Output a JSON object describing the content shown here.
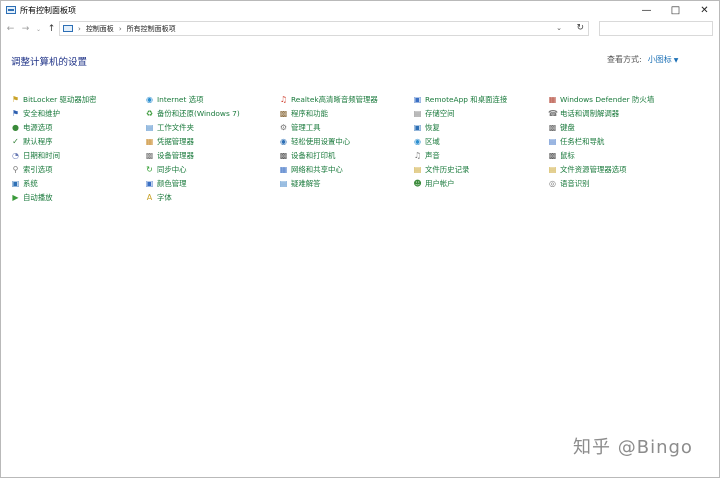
{
  "window": {
    "title": "所有控制面板项"
  },
  "addressbar": {
    "breadcrumbs": [
      "控制面板",
      "所有控制面板项"
    ]
  },
  "heading": "调整计算机的设置",
  "view_by": {
    "label": "查看方式:",
    "value": "小图标"
  },
  "columns": [
    [
      {
        "label": "BitLocker 驱动器加密",
        "icon": "key-icon",
        "color": "#c9a227"
      },
      {
        "label": "安全和维护",
        "icon": "flag-icon",
        "color": "#2d5fb0"
      },
      {
        "label": "电源选项",
        "icon": "power-icon",
        "color": "#3a8a3a"
      },
      {
        "label": "默认程序",
        "icon": "default-programs-icon",
        "color": "#2e7d32"
      },
      {
        "label": "日期和时间",
        "icon": "clock-icon",
        "color": "#6a7bb5"
      },
      {
        "label": "索引选项",
        "icon": "magnifier-icon",
        "color": "#777777"
      },
      {
        "label": "系统",
        "icon": "computer-icon",
        "color": "#2d6fb5"
      },
      {
        "label": "自动播放",
        "icon": "autoplay-icon",
        "color": "#3a9a3a"
      }
    ],
    [
      {
        "label": "Internet 选项",
        "icon": "globe-icon",
        "color": "#2d8fd0"
      },
      {
        "label": "备份和还原(Windows 7)",
        "icon": "backup-icon",
        "color": "#3a9a3a"
      },
      {
        "label": "工作文件夹",
        "icon": "folder-icon",
        "color": "#3a7fc4"
      },
      {
        "label": "凭据管理器",
        "icon": "credential-icon",
        "color": "#c88a2a"
      },
      {
        "label": "设备管理器",
        "icon": "device-manager-icon",
        "color": "#777777"
      },
      {
        "label": "同步中心",
        "icon": "sync-icon",
        "color": "#2e9d2e"
      },
      {
        "label": "颜色管理",
        "icon": "color-monitor-icon",
        "color": "#3a6fc4"
      },
      {
        "label": "字体",
        "icon": "font-icon",
        "color": "#c9a227"
      }
    ],
    [
      {
        "label": "Realtek高清晰音频管理器",
        "icon": "speaker-icon",
        "color": "#d04030"
      },
      {
        "label": "程序和功能",
        "icon": "programs-icon",
        "color": "#8a6a3a"
      },
      {
        "label": "管理工具",
        "icon": "tools-icon",
        "color": "#777777"
      },
      {
        "label": "轻松使用设置中心",
        "icon": "ease-of-access-icon",
        "color": "#2d6fb5"
      },
      {
        "label": "设备和打印机",
        "icon": "printer-icon",
        "color": "#555555"
      },
      {
        "label": "网络和共享中心",
        "icon": "network-icon",
        "color": "#3a6fc4"
      },
      {
        "label": "疑难解答",
        "icon": "troubleshoot-icon",
        "color": "#3a7fc4"
      }
    ],
    [
      {
        "label": "RemoteApp 和桌面连接",
        "icon": "remote-desktop-icon",
        "color": "#3a6fc4"
      },
      {
        "label": "存储空间",
        "icon": "storage-icon",
        "color": "#777777"
      },
      {
        "label": "恢复",
        "icon": "recovery-icon",
        "color": "#2d6fb5"
      },
      {
        "label": "区域",
        "icon": "region-icon",
        "color": "#2d8fd0"
      },
      {
        "label": "声音",
        "icon": "sound-icon",
        "color": "#777777"
      },
      {
        "label": "文件历史记录",
        "icon": "file-history-icon",
        "color": "#c9a227"
      },
      {
        "label": "用户帐户",
        "icon": "user-icon",
        "color": "#3a8a3a"
      }
    ],
    [
      {
        "label": "Windows Defender 防火墙",
        "icon": "firewall-icon",
        "color": "#b04030"
      },
      {
        "label": "电话和调制解调器",
        "icon": "phone-icon",
        "color": "#777777"
      },
      {
        "label": "键盘",
        "icon": "keyboard-icon",
        "color": "#666666"
      },
      {
        "label": "任务栏和导航",
        "icon": "taskbar-icon",
        "color": "#3a6fc4"
      },
      {
        "label": "鼠标",
        "icon": "mouse-icon",
        "color": "#555555"
      },
      {
        "label": "文件资源管理器选项",
        "icon": "folder-options-icon",
        "color": "#c9a227"
      },
      {
        "label": "语音识别",
        "icon": "microphone-icon",
        "color": "#777777"
      }
    ]
  ],
  "watermark": "知乎 @Bingo"
}
